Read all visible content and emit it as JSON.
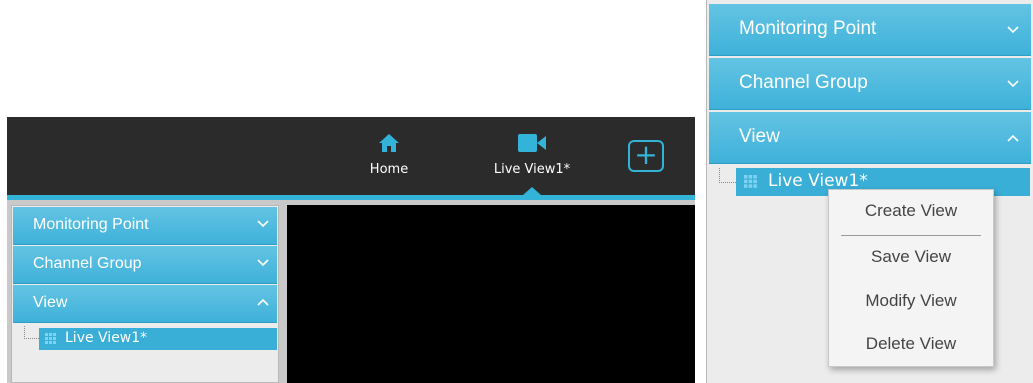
{
  "top_bar": {
    "home_label": "Home",
    "live_view_label": "Live View1",
    "live_view_star": "*",
    "add_button": "+"
  },
  "left_panel": {
    "sections": [
      {
        "title": "Monitoring Point",
        "expanded": false
      },
      {
        "title": "Channel Group",
        "expanded": false
      },
      {
        "title": "View",
        "expanded": true
      }
    ],
    "tree_item": {
      "label": "Live View1",
      "star": "*"
    }
  },
  "right_panel": {
    "sections": [
      {
        "title": "Monitoring Point",
        "expanded": false
      },
      {
        "title": "Channel Group",
        "expanded": false
      },
      {
        "title": "View",
        "expanded": true
      }
    ],
    "tree_item": {
      "label": "Live View1",
      "star": "*"
    }
  },
  "context_menu": {
    "items": [
      "Create View",
      "Save View",
      "Modify View",
      "Delete View"
    ]
  },
  "colors": {
    "accent": "#33b3d8",
    "header_bg": "#2b2b2b",
    "panel_bg": "#ececec",
    "video_bg": "#000000"
  },
  "icons": [
    "home-icon",
    "camera-icon",
    "plus-icon",
    "chevron-down-icon",
    "chevron-up-icon",
    "grid-icon"
  ]
}
